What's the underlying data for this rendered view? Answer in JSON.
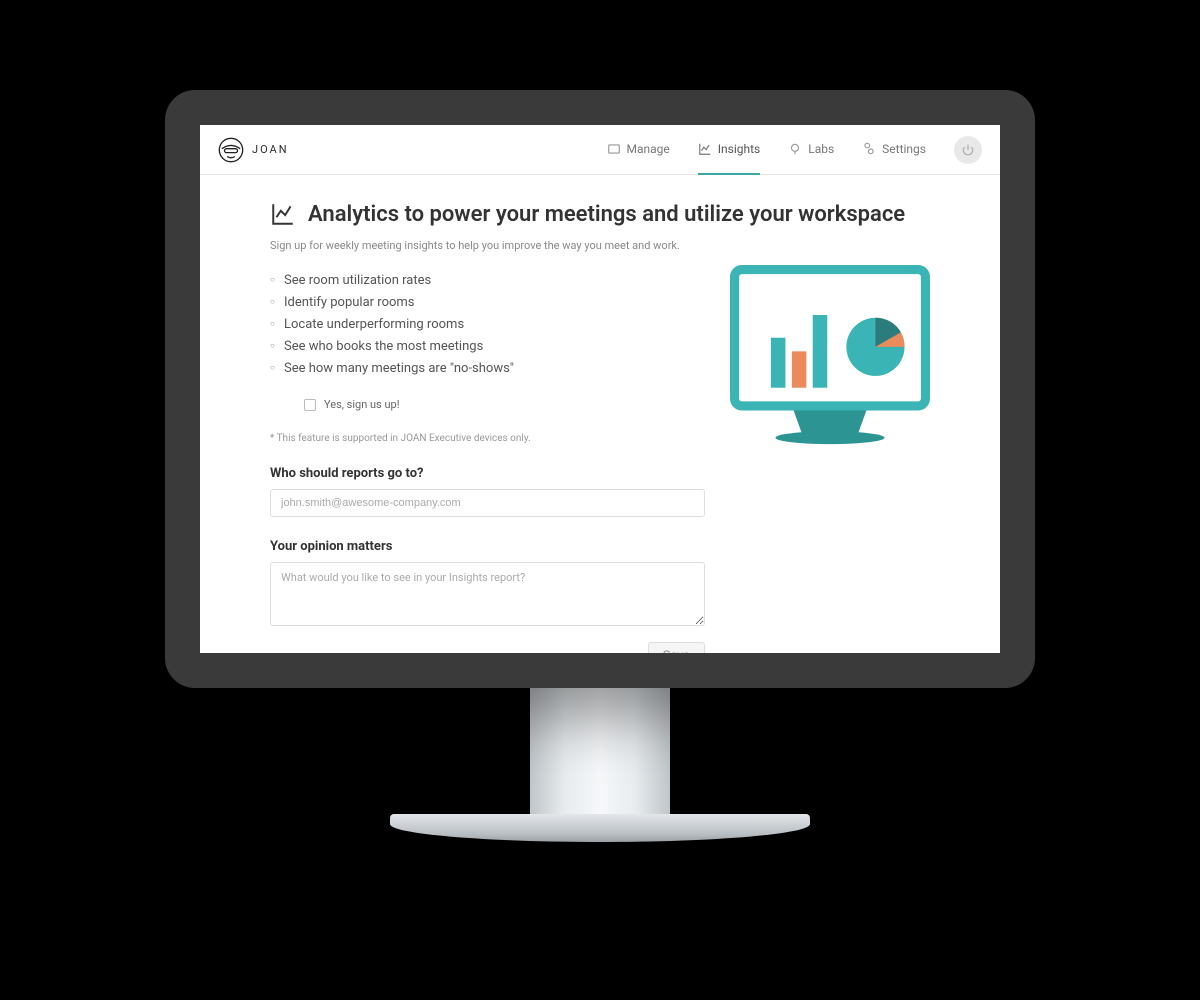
{
  "brand": {
    "name": "JOAN"
  },
  "nav": {
    "manage": "Manage",
    "insights": "Insights",
    "labs": "Labs",
    "settings": "Settings"
  },
  "page": {
    "title": "Analytics to power your meetings and utilize your workspace",
    "subtitle": "Sign up for weekly meeting insights to help you improve the way you meet and work."
  },
  "features": [
    "See room utilization rates",
    "Identify popular rooms",
    "Locate underperforming rooms",
    "See who books the most meetings",
    "See how many meetings are \"no-shows\""
  ],
  "signup_label": "Yes, sign us up!",
  "footnote": "* This feature is supported in JOAN Executive devices only.",
  "reports": {
    "heading": "Who should reports go to?",
    "placeholder": "john.smith@awesome-company.com"
  },
  "opinion": {
    "heading": "Your opinion matters",
    "placeholder": "What would you like to see in your Insights report?"
  },
  "buttons": {
    "save": "Save"
  }
}
